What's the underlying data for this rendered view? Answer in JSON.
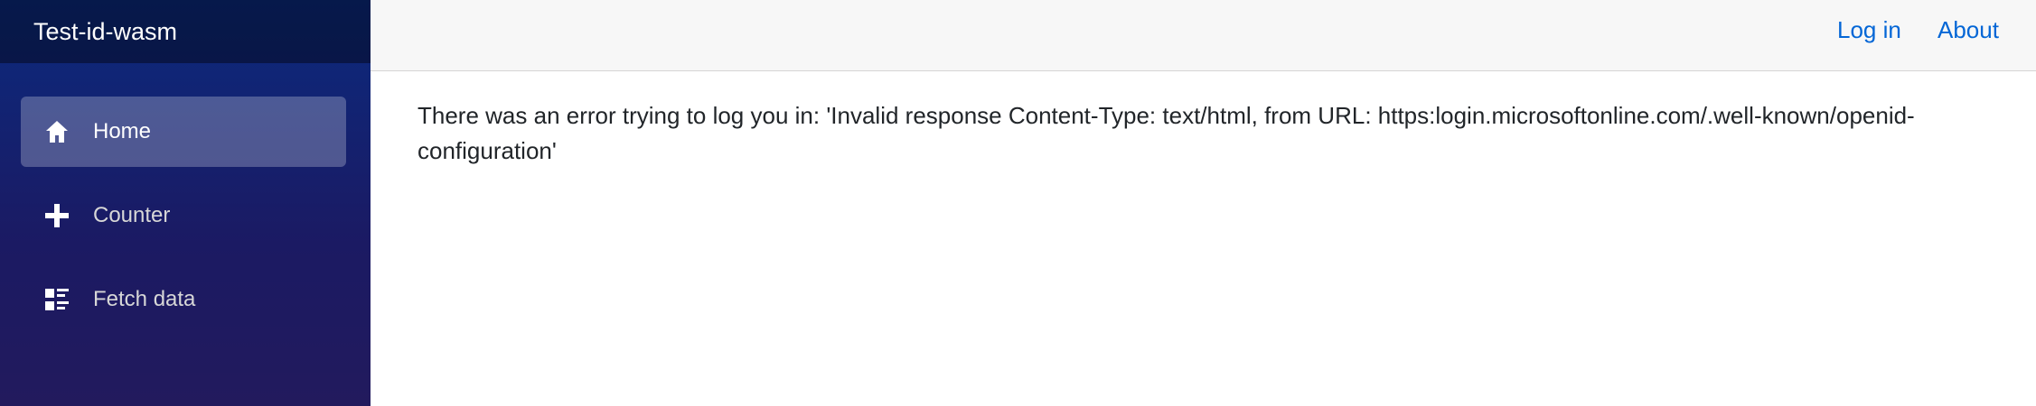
{
  "sidebar": {
    "brand": "Test-id-wasm",
    "items": [
      {
        "label": "Home",
        "icon": "home-icon",
        "active": true
      },
      {
        "label": "Counter",
        "icon": "plus-icon",
        "active": false
      },
      {
        "label": "Fetch data",
        "icon": "list-icon",
        "active": false
      }
    ]
  },
  "topbar": {
    "login_label": "Log in",
    "about_label": "About"
  },
  "main": {
    "message": "There was an error trying to log you in: 'Invalid response Content-Type: text/html, from URL: https:login.microsoftonline.com/.well-known/openid-configuration'"
  },
  "colors": {
    "link": "#0366d6",
    "sidebar_top": "#0b2a7e",
    "sidebar_bottom": "#221a5d",
    "topbar_bg": "#f7f7f7"
  }
}
